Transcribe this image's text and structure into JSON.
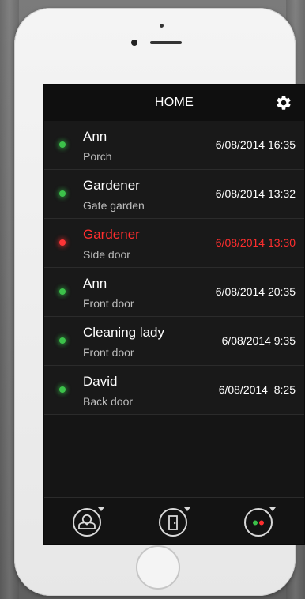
{
  "header": {
    "title": "HOME",
    "settings_icon": "gear-icon"
  },
  "log": [
    {
      "name": "Ann",
      "place": "Porch",
      "time": "6/08/2014 16:35",
      "status": "green"
    },
    {
      "name": "Gardener",
      "place": "Gate garden",
      "time": "6/08/2014 13:32",
      "status": "green"
    },
    {
      "name": "Gardener",
      "place": "Side door",
      "time": "6/08/2014 13:30",
      "status": "red"
    },
    {
      "name": "Ann",
      "place": "Front door",
      "time": "6/08/2014 20:35",
      "status": "green"
    },
    {
      "name": "Cleaning lady",
      "place": "Front door",
      "time": "6/08/2014 9:35",
      "status": "green"
    },
    {
      "name": "David",
      "place": "Back door",
      "time": "6/08/2014  8:25",
      "status": "green"
    }
  ],
  "tabs": [
    {
      "icon": "person-icon"
    },
    {
      "icon": "door-icon"
    },
    {
      "icon": "status-lights-icon"
    }
  ],
  "colors": {
    "screen_bg": "#151515",
    "ok": "#3cc14a",
    "alert": "#ff2e2e",
    "text": "#ffffff",
    "subtext": "#bdbdbd"
  }
}
